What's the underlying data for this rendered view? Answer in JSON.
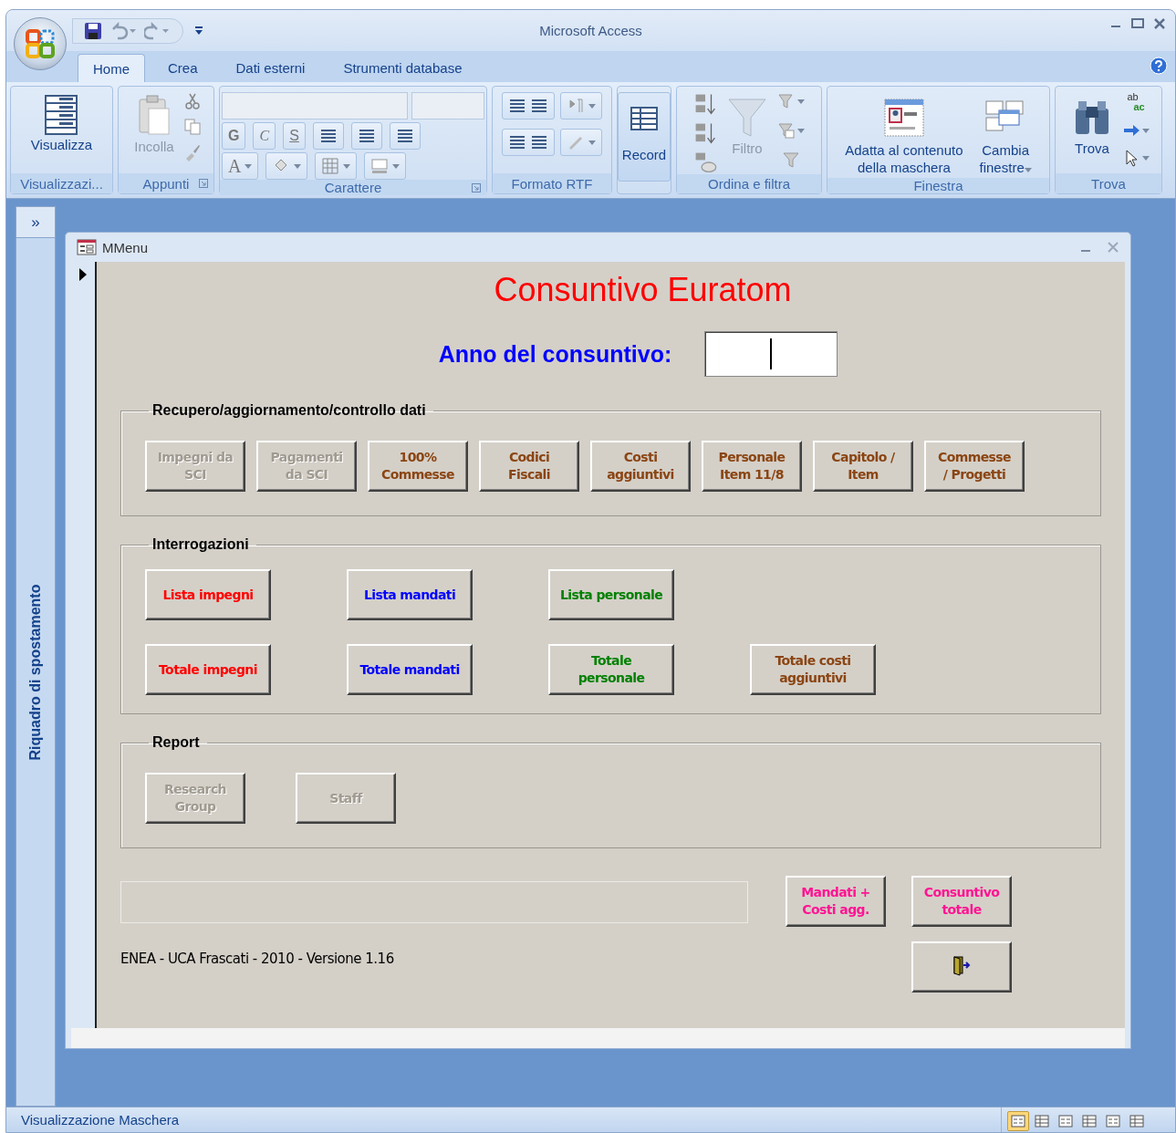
{
  "window": {
    "title": "Microsoft Access"
  },
  "tabs": [
    {
      "label": "Home",
      "selected": true
    },
    {
      "label": "Crea",
      "selected": false
    },
    {
      "label": "Dati esterni",
      "selected": false
    },
    {
      "label": "Strumenti database",
      "selected": false
    }
  ],
  "ribbon": [
    {
      "kind": "view",
      "label": "Visualizzazi...",
      "buttons": [
        {
          "label": "Visualizza",
          "disabled": false
        }
      ]
    },
    {
      "kind": "clipboard",
      "label": "Appunti",
      "buttons": [
        {
          "label": "Incolla",
          "disabled": true
        }
      ]
    },
    {
      "kind": "font",
      "label": "Carattere",
      "glyphs": [
        "G",
        "C",
        "S",
        "A"
      ]
    },
    {
      "kind": "rtf",
      "label": "Formato RTF"
    },
    {
      "kind": "records",
      "buttons": [
        {
          "label": "Record",
          "disabled": false
        }
      ]
    },
    {
      "kind": "sort",
      "label": "Ordina e filtra",
      "buttons": [
        {
          "label": "Filtro",
          "disabled": true
        }
      ]
    },
    {
      "kind": "window",
      "label": "Finestra",
      "buttons": [
        {
          "label": "Adatta al contenuto\ndella maschera",
          "disabled": false
        },
        {
          "label": "Cambia\nfinestre",
          "disabled": false
        }
      ]
    },
    {
      "kind": "find",
      "label": "Trova",
      "buttons": [
        {
          "label": "Trova",
          "disabled": false
        }
      ],
      "glyphs": [
        "ab",
        "ac"
      ]
    }
  ],
  "nav_pane": {
    "toggle": "»",
    "label": "Riquadro di spostamento"
  },
  "form": {
    "title": "MMenu",
    "heading": "Consuntivo Euratom",
    "year_label": "Anno del consuntivo:",
    "sections": [
      {
        "title": "Recupero/aggiornamento/controllo dati",
        "kind": "row",
        "rows": [
          [
            {
              "label": "Impegni da\nSCI",
              "color": "#a09a90",
              "disabled": true
            },
            {
              "label": "Pagamenti\nda SCI",
              "color": "#a09a90",
              "disabled": true
            },
            {
              "label": "100%\nCommesse",
              "color": "#8b4513",
              "disabled": false
            },
            {
              "label": "Codici\nFiscali",
              "color": "#8b4513",
              "disabled": false
            },
            {
              "label": "Costi\naggiuntivi",
              "color": "#8b4513",
              "disabled": false
            },
            {
              "label": "Personale\nItem 11/8",
              "color": "#8b4513",
              "disabled": false
            },
            {
              "label": "Capitolo /\nItem",
              "color": "#8b4513",
              "disabled": false
            },
            {
              "label": "Commesse\n/ Progetti",
              "color": "#8b4513",
              "disabled": false
            }
          ]
        ]
      },
      {
        "title": "Interrogazioni",
        "kind": "grid",
        "rows": [
          [
            {
              "label": "Lista impegni",
              "color": "#ff0000",
              "disabled": false
            },
            {
              "label": "Lista mandati",
              "color": "#0000ff",
              "disabled": false
            },
            {
              "label": "Lista personale",
              "color": "#008000",
              "disabled": false
            }
          ],
          [
            {
              "label": "Totale impegni",
              "color": "#ff0000",
              "disabled": false
            },
            {
              "label": "Totale mandati",
              "color": "#0000ff",
              "disabled": false
            },
            {
              "label": "Totale\npersonale",
              "color": "#008000",
              "disabled": false
            },
            {
              "label": "Totale costi\naggiuntivi",
              "color": "#8b4513",
              "disabled": false
            }
          ]
        ]
      },
      {
        "title": "Report",
        "kind": "row",
        "rows": [
          [
            {
              "label": "Research\nGroup",
              "color": "#a09a90",
              "disabled": true
            },
            {
              "label": "Staff",
              "color": "#a09a90",
              "disabled": true
            }
          ]
        ]
      }
    ],
    "action_buttons": [
      {
        "label": "Mandati +\nCosti agg.",
        "color": "#ff1493"
      },
      {
        "label": "Consuntivo\ntotale",
        "color": "#ff1493"
      }
    ],
    "footer": "ENEA - UCA Frascati - 2010 - Versione 1.16"
  },
  "status_bar": {
    "text": "Visualizzazione Maschera",
    "views": [
      {
        "selected": true
      },
      {
        "selected": false
      },
      {
        "selected": false
      },
      {
        "selected": false
      },
      {
        "selected": false
      },
      {
        "selected": false
      }
    ]
  }
}
